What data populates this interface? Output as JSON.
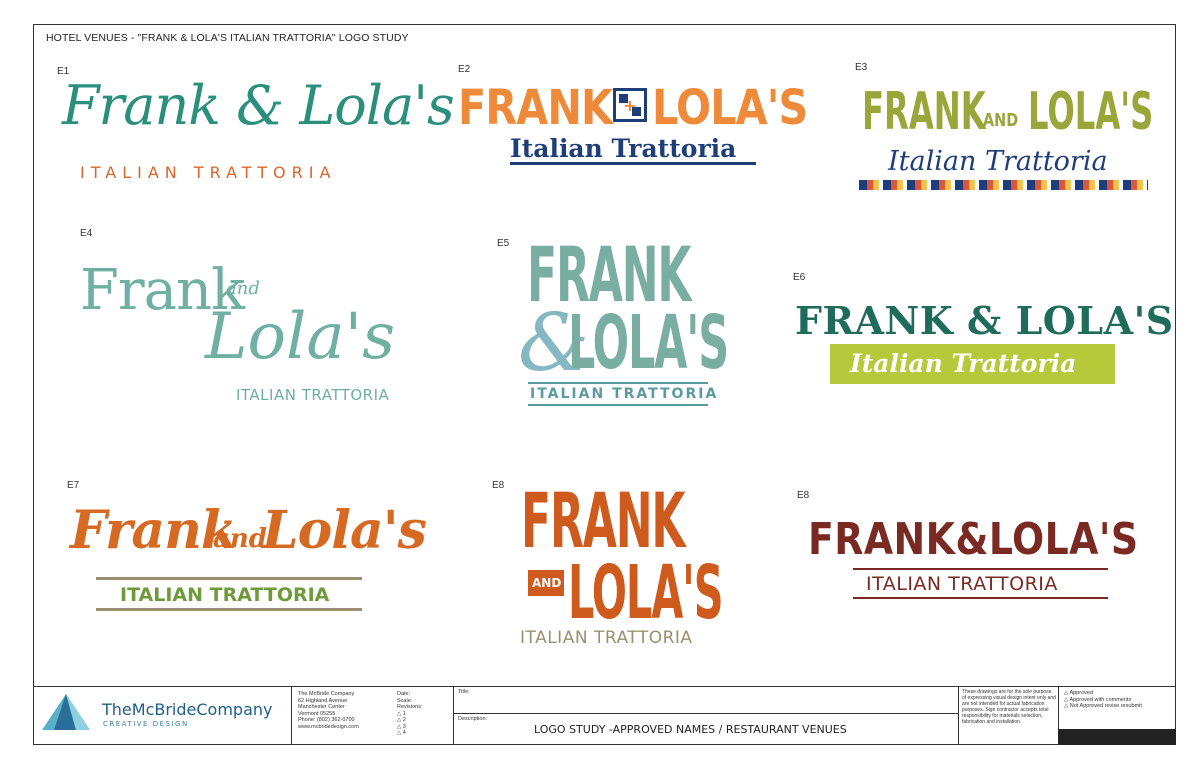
{
  "sheet": {
    "title": "HOTEL VENUES - \"FRANK & LOLA'S ITALIAN TRATTORIA\" LOGO STUDY"
  },
  "colors": {
    "teal": "#2a8f7c",
    "orange": "#e87a2c",
    "navy": "#1e3e7a",
    "olive": "#9aa53a",
    "sage": "#6fb0a2",
    "dkteal": "#1f6b5c",
    "lime": "#b5c93a",
    "rust": "#cf5a1d",
    "green": "#6e9a3a",
    "maroon": "#7a2a22",
    "taupe": "#9a8f6e"
  },
  "logos": [
    {
      "id": "E1",
      "line1": "Frank & Lola's",
      "line2": "ITALIAN TRATTORIA"
    },
    {
      "id": "E2",
      "word1": "FRANK",
      "word2": "LOLA'S",
      "line2": "Italian Trattoria"
    },
    {
      "id": "E3",
      "word1": "FRANK",
      "and": "AND",
      "word2": "LOLA'S",
      "line2": "Italian Trattoria"
    },
    {
      "id": "E4",
      "word1": "Frank",
      "and": "and",
      "word2": "Lola's",
      "line2": "ITALIAN TRATTORIA"
    },
    {
      "id": "E5",
      "word1": "FRANK",
      "amp": "&",
      "word2": "LOLA'S",
      "line2": "ITALIAN TRATTORIA"
    },
    {
      "id": "E6",
      "line1": "FRANK & LOLA'S",
      "line2": "Italian Trattoria"
    },
    {
      "id": "E7",
      "word1": "Frank",
      "and": "and",
      "word2": "Lola's",
      "line2": "ITALIAN TRATTORIA"
    },
    {
      "id": "E8",
      "word1": "FRANK",
      "and": "AND",
      "word2": "LOLA'S",
      "line2": "ITALIAN TRATTORIA"
    },
    {
      "id": "E8",
      "line1": "FRANK&LOLA'S",
      "line2": "ITALIAN TRATTORIA"
    }
  ],
  "titleblock": {
    "company": "TheMcBrideCompany",
    "tagline": "CREATIVE DESIGN",
    "address": [
      "The McBride Company",
      "62 Highland Avenue",
      "Manchester Center",
      "Vermont 05255",
      "Phone: (802) 362-0700",
      "www.mcbridedesign.com"
    ],
    "meta": [
      "Date:",
      "Scale:",
      "Revisions:",
      "△ 1",
      "△ 2",
      "△ 3",
      "△ 4"
    ],
    "title_label": "Title:",
    "desc_label": "Description:",
    "description": "LOGO STUDY -APPROVED NAMES / RESTAURANT VENUES",
    "disclaimer": "These drawings are for the sole purpose of expressing visual design intent only and are not intended for actual fabrication purposes. Sign contractor accepts total responsibility for materials selection, fabrication and installation.",
    "approvals": [
      "△ Approved",
      "△ Approved with comments",
      "△ Not Approved revise resubmit"
    ]
  }
}
